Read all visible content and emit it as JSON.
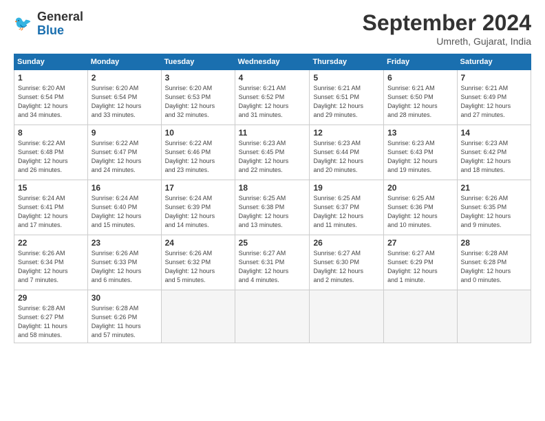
{
  "header": {
    "logo": "GeneralBlue",
    "title": "September 2024",
    "location": "Umreth, Gujarat, India"
  },
  "days_of_week": [
    "Sunday",
    "Monday",
    "Tuesday",
    "Wednesday",
    "Thursday",
    "Friday",
    "Saturday"
  ],
  "weeks": [
    [
      {
        "num": "1",
        "info": "Sunrise: 6:20 AM\nSunset: 6:54 PM\nDaylight: 12 hours\nand 34 minutes."
      },
      {
        "num": "2",
        "info": "Sunrise: 6:20 AM\nSunset: 6:54 PM\nDaylight: 12 hours\nand 33 minutes."
      },
      {
        "num": "3",
        "info": "Sunrise: 6:20 AM\nSunset: 6:53 PM\nDaylight: 12 hours\nand 32 minutes."
      },
      {
        "num": "4",
        "info": "Sunrise: 6:21 AM\nSunset: 6:52 PM\nDaylight: 12 hours\nand 31 minutes."
      },
      {
        "num": "5",
        "info": "Sunrise: 6:21 AM\nSunset: 6:51 PM\nDaylight: 12 hours\nand 29 minutes."
      },
      {
        "num": "6",
        "info": "Sunrise: 6:21 AM\nSunset: 6:50 PM\nDaylight: 12 hours\nand 28 minutes."
      },
      {
        "num": "7",
        "info": "Sunrise: 6:21 AM\nSunset: 6:49 PM\nDaylight: 12 hours\nand 27 minutes."
      }
    ],
    [
      {
        "num": "8",
        "info": "Sunrise: 6:22 AM\nSunset: 6:48 PM\nDaylight: 12 hours\nand 26 minutes."
      },
      {
        "num": "9",
        "info": "Sunrise: 6:22 AM\nSunset: 6:47 PM\nDaylight: 12 hours\nand 24 minutes."
      },
      {
        "num": "10",
        "info": "Sunrise: 6:22 AM\nSunset: 6:46 PM\nDaylight: 12 hours\nand 23 minutes."
      },
      {
        "num": "11",
        "info": "Sunrise: 6:23 AM\nSunset: 6:45 PM\nDaylight: 12 hours\nand 22 minutes."
      },
      {
        "num": "12",
        "info": "Sunrise: 6:23 AM\nSunset: 6:44 PM\nDaylight: 12 hours\nand 20 minutes."
      },
      {
        "num": "13",
        "info": "Sunrise: 6:23 AM\nSunset: 6:43 PM\nDaylight: 12 hours\nand 19 minutes."
      },
      {
        "num": "14",
        "info": "Sunrise: 6:23 AM\nSunset: 6:42 PM\nDaylight: 12 hours\nand 18 minutes."
      }
    ],
    [
      {
        "num": "15",
        "info": "Sunrise: 6:24 AM\nSunset: 6:41 PM\nDaylight: 12 hours\nand 17 minutes."
      },
      {
        "num": "16",
        "info": "Sunrise: 6:24 AM\nSunset: 6:40 PM\nDaylight: 12 hours\nand 15 minutes."
      },
      {
        "num": "17",
        "info": "Sunrise: 6:24 AM\nSunset: 6:39 PM\nDaylight: 12 hours\nand 14 minutes."
      },
      {
        "num": "18",
        "info": "Sunrise: 6:25 AM\nSunset: 6:38 PM\nDaylight: 12 hours\nand 13 minutes."
      },
      {
        "num": "19",
        "info": "Sunrise: 6:25 AM\nSunset: 6:37 PM\nDaylight: 12 hours\nand 11 minutes."
      },
      {
        "num": "20",
        "info": "Sunrise: 6:25 AM\nSunset: 6:36 PM\nDaylight: 12 hours\nand 10 minutes."
      },
      {
        "num": "21",
        "info": "Sunrise: 6:26 AM\nSunset: 6:35 PM\nDaylight: 12 hours\nand 9 minutes."
      }
    ],
    [
      {
        "num": "22",
        "info": "Sunrise: 6:26 AM\nSunset: 6:34 PM\nDaylight: 12 hours\nand 7 minutes."
      },
      {
        "num": "23",
        "info": "Sunrise: 6:26 AM\nSunset: 6:33 PM\nDaylight: 12 hours\nand 6 minutes."
      },
      {
        "num": "24",
        "info": "Sunrise: 6:26 AM\nSunset: 6:32 PM\nDaylight: 12 hours\nand 5 minutes."
      },
      {
        "num": "25",
        "info": "Sunrise: 6:27 AM\nSunset: 6:31 PM\nDaylight: 12 hours\nand 4 minutes."
      },
      {
        "num": "26",
        "info": "Sunrise: 6:27 AM\nSunset: 6:30 PM\nDaylight: 12 hours\nand 2 minutes."
      },
      {
        "num": "27",
        "info": "Sunrise: 6:27 AM\nSunset: 6:29 PM\nDaylight: 12 hours\nand 1 minute."
      },
      {
        "num": "28",
        "info": "Sunrise: 6:28 AM\nSunset: 6:28 PM\nDaylight: 12 hours\nand 0 minutes."
      }
    ],
    [
      {
        "num": "29",
        "info": "Sunrise: 6:28 AM\nSunset: 6:27 PM\nDaylight: 11 hours\nand 58 minutes."
      },
      {
        "num": "30",
        "info": "Sunrise: 6:28 AM\nSunset: 6:26 PM\nDaylight: 11 hours\nand 57 minutes."
      },
      {
        "num": "",
        "info": ""
      },
      {
        "num": "",
        "info": ""
      },
      {
        "num": "",
        "info": ""
      },
      {
        "num": "",
        "info": ""
      },
      {
        "num": "",
        "info": ""
      }
    ]
  ]
}
